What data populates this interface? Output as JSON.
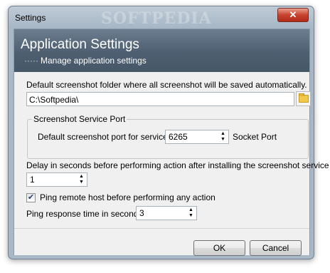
{
  "window": {
    "title": "Settings",
    "watermark": "SOFTPEDIA",
    "close_glyph": "✕"
  },
  "header": {
    "title": "Application Settings",
    "subtitle_prefix": "·····",
    "subtitle": "Manage application settings"
  },
  "folder": {
    "label": "Default screenshot folder where all screenshot will be saved automatically.",
    "value": "C:\\Softpedia\\",
    "browse_icon": "folder-icon"
  },
  "port_group": {
    "title": "Screenshot Service Port",
    "label": "Default screenshot port for service:",
    "value": "6265",
    "suffix": "Socket Port"
  },
  "delay": {
    "label": "Delay in seconds before performing action after installing the screenshot service",
    "value": "1"
  },
  "ping": {
    "checkbox_label": "Ping remote host before performing any action",
    "checked": true,
    "check_glyph": "✔",
    "response_label": "Ping response time in seconds:",
    "response_value": "3"
  },
  "spin_glyphs": {
    "up": "▲",
    "down": "▼"
  },
  "buttons": {
    "ok": "OK",
    "cancel": "Cancel"
  }
}
